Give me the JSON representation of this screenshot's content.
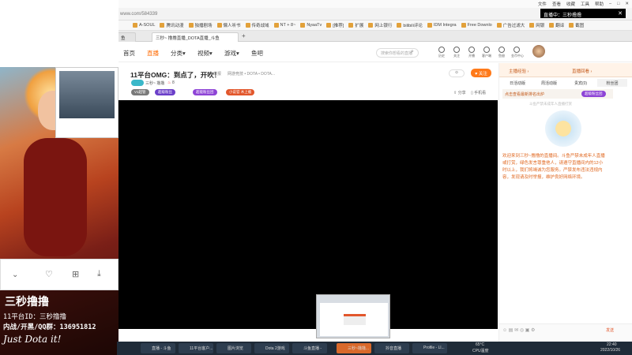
{
  "browser": {
    "url": "www.com/584339",
    "menu": [
      "文件",
      "查看",
      "收藏",
      "工具",
      "帮助"
    ],
    "bookmarks": [
      "A-SOUL",
      "腾讯动漫",
      "独播剧场",
      "懒人听书",
      "传奇战域",
      "NT + 8~",
      "NyaaTv",
      "[推荐]",
      "扩展",
      "网上银行",
      "bilibili评论",
      "IDM Integra",
      "Free Downlo",
      "广告过滤大",
      "网银",
      "翻译",
      "截图"
    ],
    "tabs": [
      "鱼",
      "三秒~ 撸撸直播_DOTA直播_斗鱼",
      "+"
    ]
  },
  "nav": {
    "items": [
      "首页",
      "直播",
      "分类▾",
      "视频▾",
      "游戏▾",
      "鱼吧"
    ],
    "search_placeholder": "搜索你想看的直播",
    "icons": [
      "历史",
      "关注",
      "开播",
      "客户端",
      "鱼翅",
      "金币中心"
    ]
  },
  "room": {
    "title": "11平台OMG：到点了，开吹！",
    "report": "举报",
    "category": "网游竞技 • DOTA • DOTA...",
    "streamer": "三秒~ 撸撸",
    "hot": "8",
    "follow": "关注",
    "badges": [
      "V1超管",
      "超级粉丝",
      "超能粉丝团",
      "小说官 木上瘾"
    ],
    "share": "分享",
    "mobile_watch": "手机看"
  },
  "right_panel": {
    "header_left": "主播经验 ›",
    "header_right": "直播回看 ›",
    "tabs": [
      "日活动版",
      "周活动版",
      "贵宾(0)",
      "粉丝团"
    ],
    "ad_text": "点击查看最新排名出炉",
    "ad_button": "超级粉丝团",
    "empty_text": "斗鱼严禁未成年人直播打赏",
    "notice": "欢迎来到三秒~撸撸的直播间。斗鱼严禁未成年人直播或打赏，绿色发言尊重他人，请遵守直播间内的12小时以上，我们将竭诚为您服务。严禁发布违法违规内容，发现请及时举报，维护良好网络环境。",
    "send_label": "发送"
  },
  "overlay": {
    "streamer_name": "三秒撸撸",
    "platform_id": "11平台ID：三秒撸撸",
    "qq_group": "内战/开黑/QQ群：136951812",
    "slogan": "Just Dota it!"
  },
  "taskbar": {
    "tasks": [
      "直播 - 斗鱼",
      "11平台客户...",
      "图片浏览",
      "Dota 2游戏",
      "斗鱼直播 -",
      "三秒~撸撸...",
      "抖音直播",
      "Profile - Ll..."
    ],
    "active_index": 5,
    "temp": "65°C",
    "cpu": "CPU温度",
    "time": "22:40",
    "date": "2022/10/26"
  },
  "live_notification": "直播中：三秒撸撸"
}
